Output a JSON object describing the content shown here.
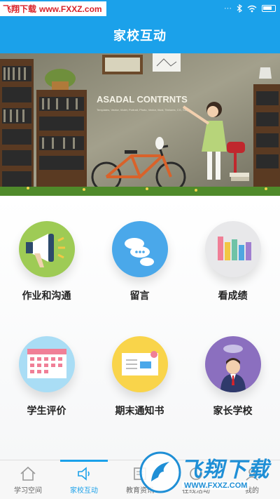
{
  "watermark_top": {
    "part1": "飞翔下载",
    "part2": "www.FXXZ.com"
  },
  "status": {
    "battery": ""
  },
  "header": {
    "title": "家校互动"
  },
  "banner": {
    "headline": "ASADAL CONTRNTS",
    "subline": "Templates, Vector, Violet, Portrait, Photo, Vector, Illust, Textures, CG, Stage"
  },
  "features": [
    {
      "label": "作业和沟通",
      "icon": "megaphone-icon",
      "color": "#9ecb55"
    },
    {
      "label": "留言",
      "icon": "chat-clouds-icon",
      "color": "#4aa8ea"
    },
    {
      "label": "看成绩",
      "icon": "bar-chart-icon",
      "color": "#e8e8ea"
    },
    {
      "label": "学生评价",
      "icon": "calendar-icon",
      "color": "#a9ddf5"
    },
    {
      "label": "期末通知书",
      "icon": "envelope-icon",
      "color": "#f9d44a"
    },
    {
      "label": "家长学校",
      "icon": "teacher-icon",
      "color": "#8b6fbf"
    }
  ],
  "tabs": [
    {
      "label": "学习空间",
      "icon": "home-icon",
      "active": false
    },
    {
      "label": "家校互动",
      "icon": "speaker-icon",
      "active": true
    },
    {
      "label": "教育资讯",
      "icon": "news-icon",
      "active": false
    },
    {
      "label": "在线活动",
      "icon": "activity-icon",
      "active": false
    },
    {
      "label": "我的",
      "icon": "user-icon",
      "active": false
    }
  ],
  "watermark_bottom": {
    "brand": "飞翔下载",
    "url": "WWW.FXXZ.COM"
  }
}
